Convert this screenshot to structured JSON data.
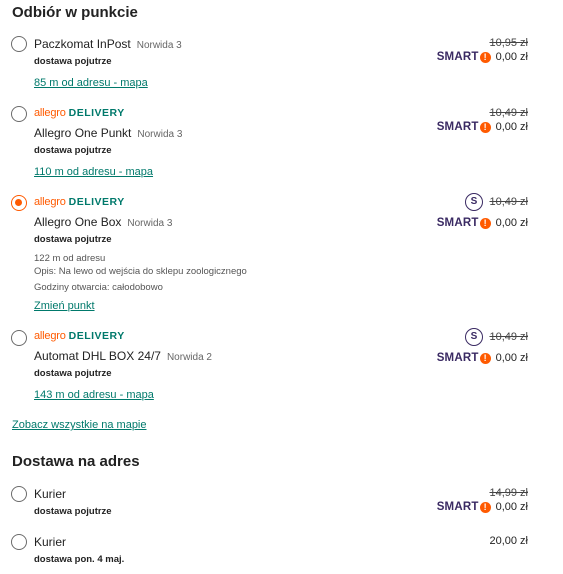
{
  "pickup": {
    "title": "Odbiór w punkcie",
    "options": [
      {
        "brand": "",
        "name": "Paczkomat InPost",
        "address": "Norwida 3",
        "delivery": "dostawa pojutrze",
        "link": "85 m od adresu - mapa",
        "old_price": "10,95 zł",
        "smart": "SMART",
        "new_price": "0,00 zł",
        "selected": false
      },
      {
        "brand": "allegro DELIVERY",
        "name": "Allegro One Punkt",
        "address": "Norwida 3",
        "delivery": "dostawa pojutrze",
        "link": "110 m od adresu - mapa",
        "old_price": "10,49 zł",
        "smart": "SMART",
        "new_price": "0,00 zł",
        "selected": false
      },
      {
        "brand": "allegro DELIVERY",
        "name": "Allegro One Box",
        "address": "Norwida 3",
        "delivery": "dostawa pojutrze",
        "distance": "122 m od adresu",
        "description": "Opis: Na lewo od wejścia do sklepu zoologicznego",
        "hours": "Godziny otwarcia: całodobowo",
        "link": "Zmień punkt",
        "old_price": "10,49 zł",
        "smart": "SMART",
        "new_price": "0,00 zł",
        "badge": "S",
        "selected": true
      },
      {
        "brand": "allegro DELIVERY",
        "name": "Automat DHL BOX 24/7",
        "address": "Norwida 2",
        "delivery": "dostawa pojutrze",
        "link": "143 m od adresu - mapa",
        "old_price": "10,49 zł",
        "smart": "SMART",
        "new_price": "0,00 zł",
        "badge": "S",
        "selected": false
      }
    ],
    "see_all": "Zobacz wszystkie na mapie"
  },
  "address_delivery": {
    "title": "Dostawa na adres",
    "options": [
      {
        "name": "Kurier",
        "delivery": "dostawa pojutrze",
        "old_price": "14,99 zł",
        "smart": "SMART",
        "new_price": "0,00 zł",
        "selected": false
      },
      {
        "name": "Kurier",
        "delivery": "dostawa pon. 4 maj.",
        "price": "20,00 zł",
        "selected": false
      }
    ]
  },
  "colors": {
    "accent": "#ff5a00",
    "link": "#00796b",
    "smart": "#3a2a63"
  }
}
